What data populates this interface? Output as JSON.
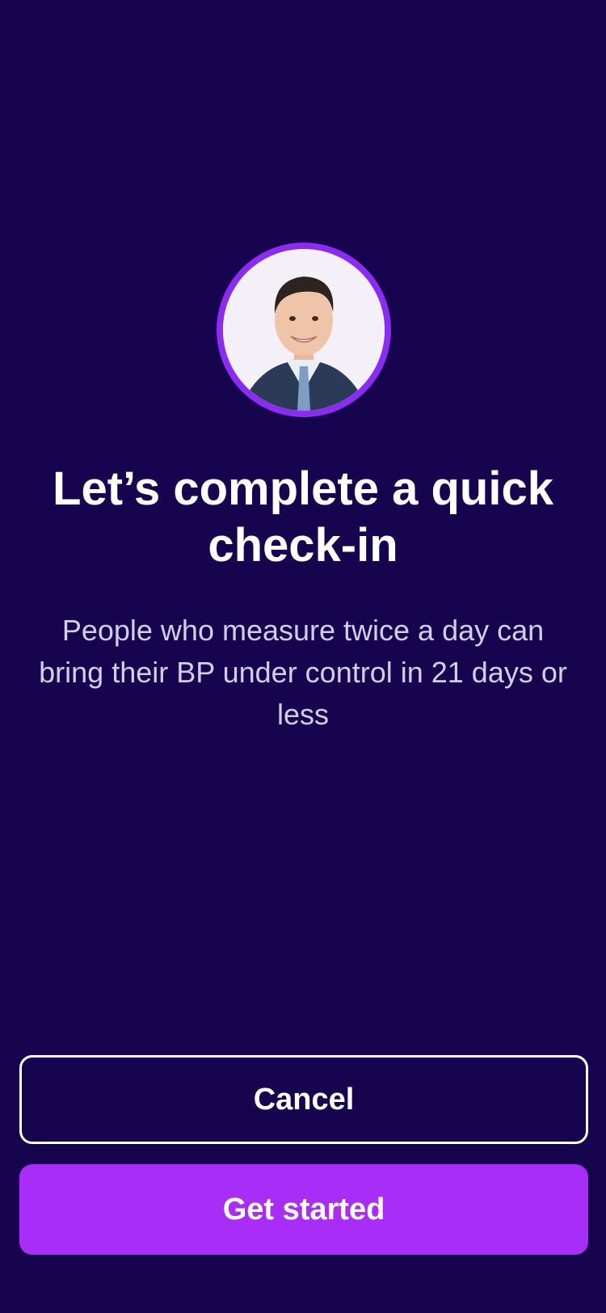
{
  "colors": {
    "background": "#16054e",
    "accent": "#a82df7",
    "avatar_ring": "#8a2cf2",
    "subtitle_text": "#d4cde8"
  },
  "header": {
    "avatar_icon": "coach-portrait"
  },
  "main": {
    "title": "Let’s complete a quick check-in",
    "subtitle": "People who measure twice a day can bring their BP under control in 21 days or less"
  },
  "actions": {
    "cancel_label": "Cancel",
    "start_label": "Get started"
  }
}
